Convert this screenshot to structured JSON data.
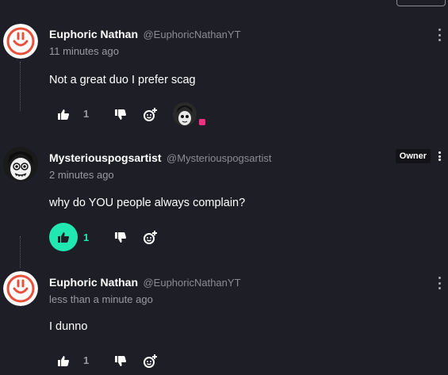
{
  "comments": [
    {
      "author": "Euphoric Nathan",
      "handle": "@EuphoricNathanYT",
      "time": "11 minutes ago",
      "text": "Not a great duo I prefer scag",
      "likes": "1",
      "liked": false,
      "avatar_color": "#e8503a",
      "has_reaction_avatar": true
    },
    {
      "author": "Mysteriouspogsartist",
      "handle": "@Mysteriouspogsartist",
      "badge": "Owner",
      "time": "2 minutes ago",
      "text": "why do YOU people always complain?",
      "likes": "1",
      "liked": true
    },
    {
      "author": "Euphoric Nathan",
      "handle": "@EuphoricNathanYT",
      "time": "less than a minute ago",
      "text": "I dunno",
      "likes": "1",
      "liked": false
    }
  ],
  "colors": {
    "background": "#1e1e26",
    "accent": "#20e8b0",
    "muted_text": "#9a9aa4",
    "reaction_dot": "#ff2e83"
  }
}
